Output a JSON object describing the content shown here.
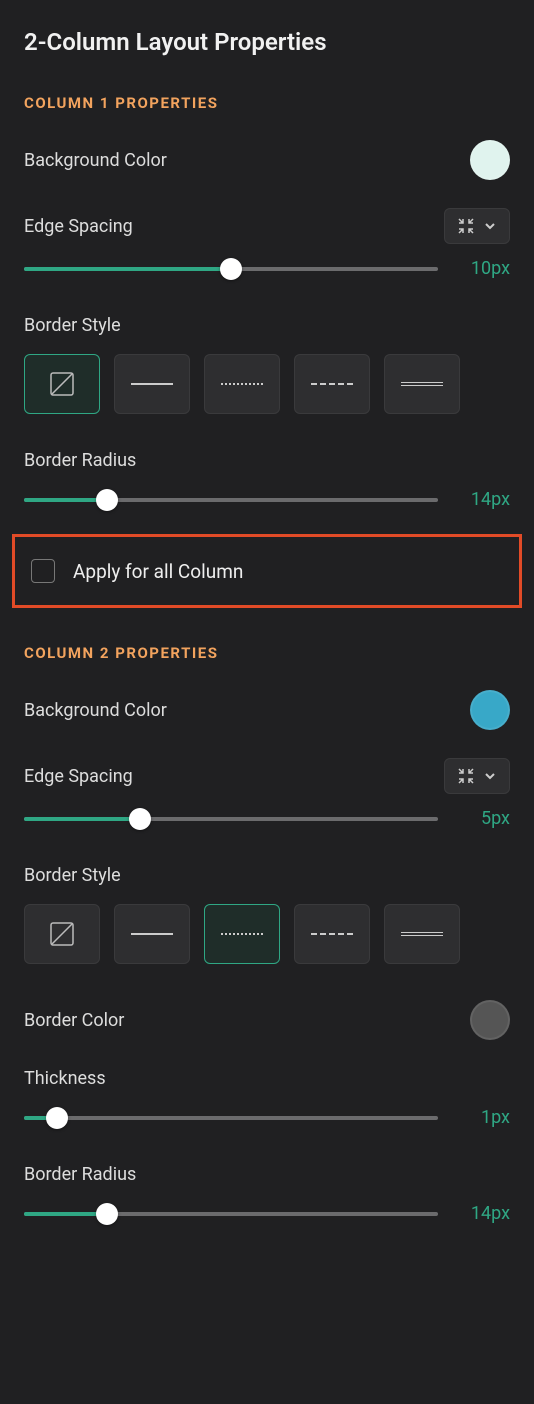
{
  "title": "2-Column Layout Properties",
  "col1": {
    "header": "COLUMN 1 PROPERTIES",
    "bg_label": "Background Color",
    "edge_label": "Edge Spacing",
    "edge_value": "10px",
    "border_style_label": "Border Style",
    "radius_label": "Border Radius",
    "radius_value": "14px",
    "apply_all_label": "Apply for all Column"
  },
  "col2": {
    "header": "COLUMN 2 PROPERTIES",
    "bg_label": "Background Color",
    "edge_label": "Edge Spacing",
    "edge_value": "5px",
    "border_style_label": "Border Style",
    "border_color_label": "Border Color",
    "thickness_label": "Thickness",
    "thickness_value": "1px",
    "radius_label": "Border Radius",
    "radius_value": "14px"
  }
}
